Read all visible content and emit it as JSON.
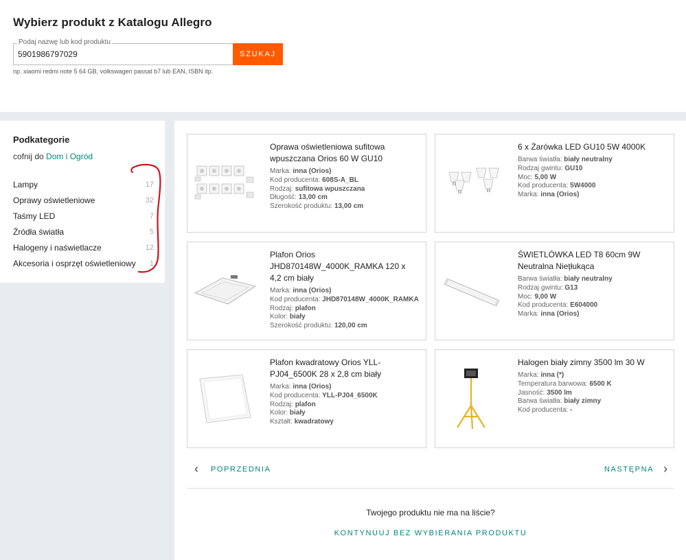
{
  "header": {
    "title": "Wybierz produkt z Katalogu Allegro",
    "search_label": "Podaj nazwę lub kod produktu",
    "search_value": "5901986797029",
    "search_button": "SZUKAJ",
    "hint": "np. xiaomi redmi note 5 64 GB, volkswagen passat b7 lub EAN, ISBN itp."
  },
  "sidebar": {
    "title": "Podkategorie",
    "back_prefix": "cofnij do ",
    "back_link": "Dom i Ogród",
    "categories": [
      {
        "label": "Lampy",
        "count": "17"
      },
      {
        "label": "Oprawy oświetleniowe",
        "count": "32"
      },
      {
        "label": "Taśmy LED",
        "count": "7"
      },
      {
        "label": "Źródła światła",
        "count": "5"
      },
      {
        "label": "Halogeny i naświetlacze",
        "count": "12"
      },
      {
        "label": "Akcesoria i osprzęt oświetleniowy",
        "count": "1"
      }
    ]
  },
  "products": [
    {
      "title": "Oprawa oświetleniowa sufitowa wpuszczana Orios 60 W GU10",
      "attrs": [
        {
          "k": "Marka: ",
          "v": "inna (Orios)"
        },
        {
          "k": "Kod producenta: ",
          "v": "608S-A_BL"
        },
        {
          "k": "Rodzaj: ",
          "v": "sufitowa wpuszczana"
        },
        {
          "k": "Długość: ",
          "v": "13,00 cm"
        },
        {
          "k": "Szerokość produktu: ",
          "v": "13,00 cm"
        }
      ]
    },
    {
      "title": "6 x Żarówka LED GU10 5W 4000K",
      "attrs": [
        {
          "k": "Barwa światła: ",
          "v": "biały neutralny"
        },
        {
          "k": "Rodzaj gwintu: ",
          "v": "GU10"
        },
        {
          "k": "Moc: ",
          "v": "5,00 W"
        },
        {
          "k": "Kod producenta: ",
          "v": "5W4000"
        },
        {
          "k": "Marka: ",
          "v": "inna (Orios)"
        }
      ]
    },
    {
      "title": "Plafon Orios JHD870148W_4000K_RAMKA 120 x 4,2 cm biały",
      "attrs": [
        {
          "k": "Marka: ",
          "v": "inna (Orios)"
        },
        {
          "k": "Kod producenta: ",
          "v": "JHD870148W_4000K_RAMKA"
        },
        {
          "k": "Rodzaj: ",
          "v": "plafon"
        },
        {
          "k": "Kolor: ",
          "v": "biały"
        },
        {
          "k": "Szerokość produktu: ",
          "v": "120,00 cm"
        }
      ]
    },
    {
      "title": "ŚWIETLÓWKA LED T8 60cm 9W Neutralna Niețłukąca",
      "attrs": [
        {
          "k": "Barwa światła: ",
          "v": "biały neutralny"
        },
        {
          "k": "Rodzaj gwintu: ",
          "v": "G13"
        },
        {
          "k": "Moc: ",
          "v": "9,00 W"
        },
        {
          "k": "Kod producenta: ",
          "v": "E604000"
        },
        {
          "k": "Marka: ",
          "v": "inna (Orios)"
        }
      ]
    },
    {
      "title": "Plafon kwadratowy Orios YLL-PJ04_6500K 28 x 2,8 cm biały",
      "attrs": [
        {
          "k": "Marka: ",
          "v": "inna (Orios)"
        },
        {
          "k": "Kod producenta: ",
          "v": "YLL-PJ04_6500K"
        },
        {
          "k": "Rodzaj: ",
          "v": "plafon"
        },
        {
          "k": "Kolor: ",
          "v": "biały"
        },
        {
          "k": "Kształt: ",
          "v": "kwadratowy"
        }
      ]
    },
    {
      "title": "Halogen biały zimny 3500 lm 30 W",
      "attrs": [
        {
          "k": "Marka: ",
          "v": "inna (*)"
        },
        {
          "k": "Temperatura barwowa: ",
          "v": "6500 K"
        },
        {
          "k": "Jasność: ",
          "v": "3500 lm"
        },
        {
          "k": "Barwa światła: ",
          "v": "biały zimny"
        },
        {
          "k": "Kod producenta: ",
          "v": "-"
        }
      ]
    }
  ],
  "pagination": {
    "prev": "POPRZEDNIA",
    "next": "NASTĘPNA"
  },
  "footer": {
    "question": "Twojego produktu nie ma na liście?",
    "continue": "KONTYNUUJ BEZ WYBIERANIA PRODUKTU"
  },
  "colors": {
    "accent": "#ff5a00",
    "link": "#00857a",
    "annotation": "#d0121b"
  }
}
